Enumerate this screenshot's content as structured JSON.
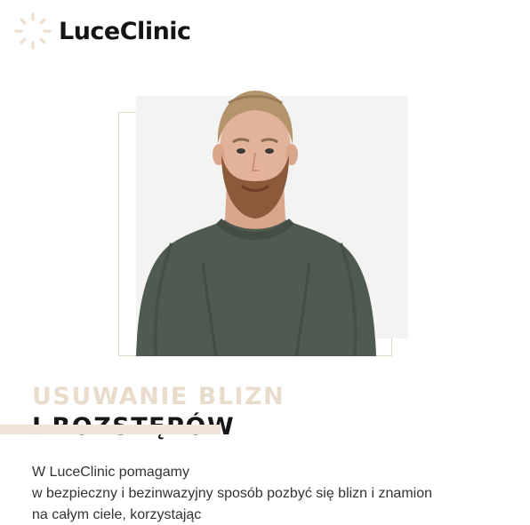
{
  "brand": {
    "name": "LuceClinic",
    "logo_icon": "sunburst-logo-icon",
    "accent_color": "#e3d7c6"
  },
  "hero": {
    "image_icon": "man-portrait-photo"
  },
  "heading": {
    "line1": "USUWANIE BLIZN",
    "line2": "I ROZSTĘPÓW"
  },
  "intro": {
    "line1": "W LuceClinic pomagamy",
    "line2": "w bezpieczny i bezinwazyjny sposób pozbyć się blizn i znamion",
    "line3": "na całym ciele, korzystając"
  }
}
